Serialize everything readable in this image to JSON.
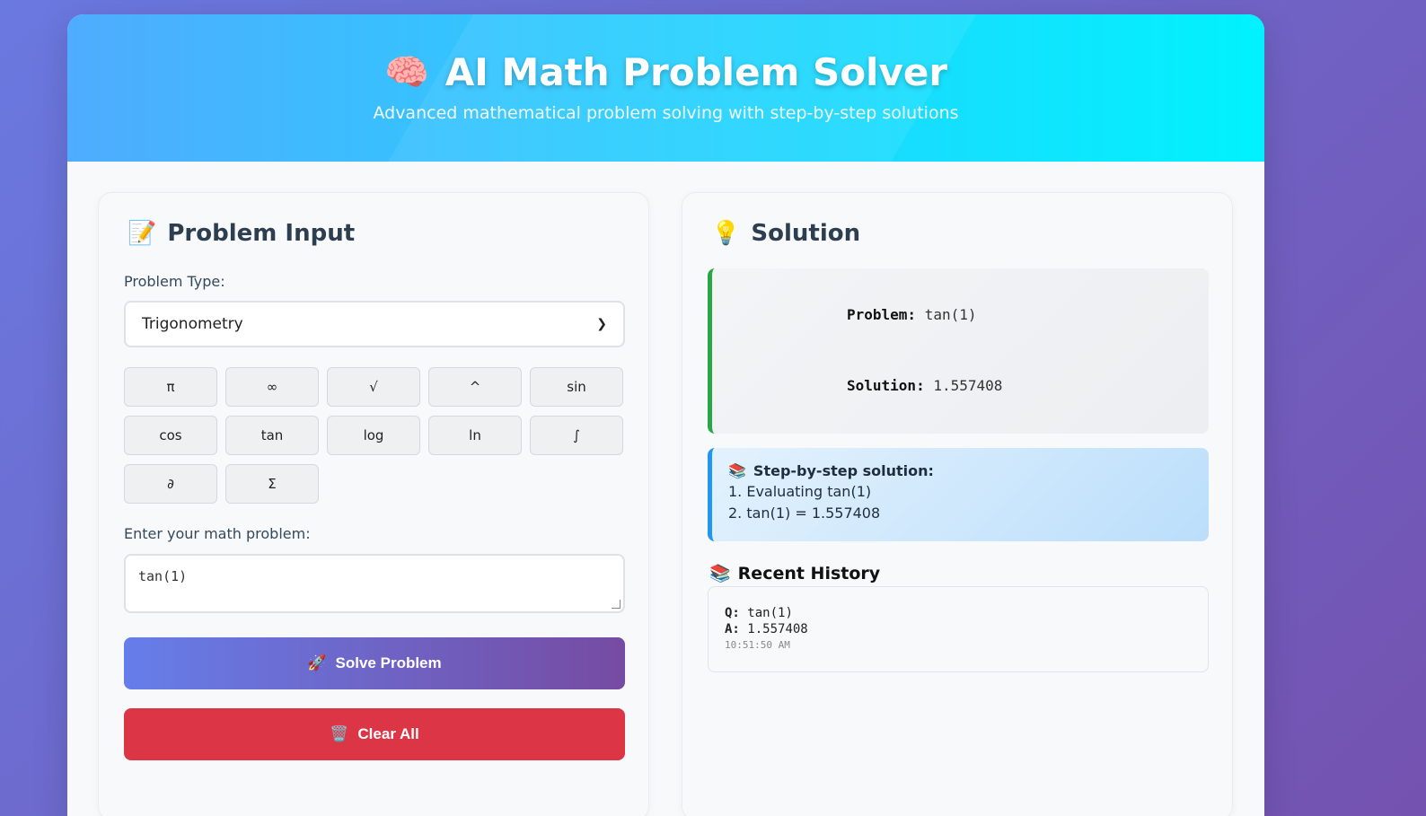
{
  "header": {
    "title_icon": "🧠",
    "title": "AI Math Problem Solver",
    "subtitle": "Advanced mathematical problem solving with step-by-step solutions"
  },
  "input_panel": {
    "title_icon": "📝",
    "title": "Problem Input",
    "type_label": "Problem Type:",
    "type_selected": "Trigonometry",
    "symbols": [
      "π",
      "∞",
      "√",
      "^",
      "sin",
      "cos",
      "tan",
      "log",
      "ln",
      "∫",
      "∂",
      "Σ"
    ],
    "problem_label": "Enter your math problem:",
    "problem_value": "tan(1)",
    "solve_icon": "🚀",
    "solve_label": "Solve Problem",
    "clear_icon": "🗑️",
    "clear_label": "Clear All"
  },
  "solution_panel": {
    "title_icon": "💡",
    "title": "Solution",
    "problem_label": "Problem:",
    "problem_value": "tan(1)",
    "solution_label": "Solution:",
    "solution_value": "1.557408",
    "steps_icon": "📚",
    "steps_title": "Step-by-step solution:",
    "steps": [
      "1. Evaluating tan(1)",
      "2. tan(1) = 1.557408"
    ],
    "history_icon": "📚",
    "history_title": "Recent History",
    "history": [
      {
        "q_label": "Q:",
        "q": "tan(1)",
        "a_label": "A:",
        "a": "1.557408",
        "time": "10:51:50 AM"
      }
    ]
  },
  "colors": {
    "header_start": "#4facfe",
    "header_end": "#00f2fe",
    "solve_start": "#667eea",
    "solve_end": "#764ba2",
    "clear": "#dc3545",
    "result_accent": "#28a745",
    "steps_accent": "#2196f3"
  }
}
